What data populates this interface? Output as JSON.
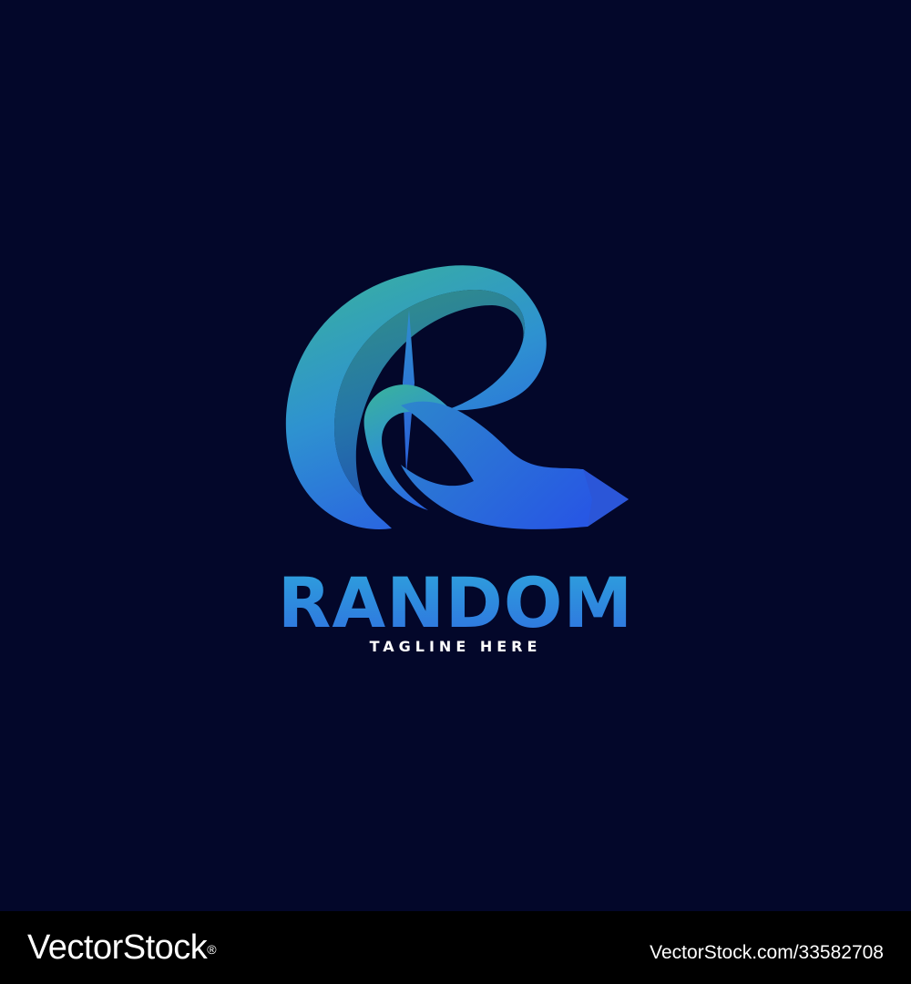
{
  "logo": {
    "letter_icon": "r-ribbon-logo-icon",
    "wordmark": "RANDOM",
    "tagline": "TAGLINE HERE",
    "colors": {
      "background": "#03072a",
      "gradient_start": "#3ab49a",
      "gradient_mid": "#2e8fd6",
      "gradient_end": "#2a5fe2",
      "tagline": "#ffffff"
    }
  },
  "watermark": {
    "brand": "VectorStock",
    "registered": "®",
    "image_id": "VectorStock.com/33582708",
    "background": "#000000"
  }
}
